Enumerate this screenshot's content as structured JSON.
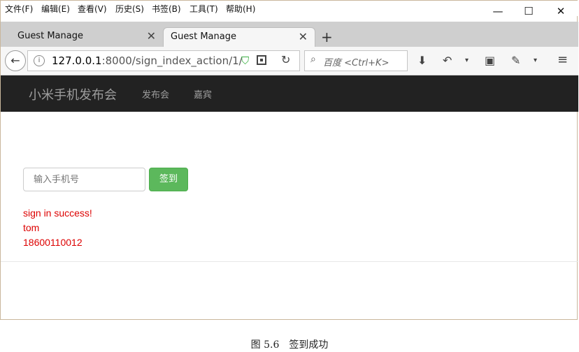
{
  "menubar": {
    "items": [
      "文件(F)",
      "编辑(E)",
      "查看(V)",
      "历史(S)",
      "书签(B)",
      "工具(T)",
      "帮助(H)"
    ]
  },
  "window_controls": {
    "minimize": "—",
    "maximize": "☐",
    "close": "✕"
  },
  "tabs": [
    {
      "title": "Guest Manage",
      "active": false
    },
    {
      "title": "Guest Manage",
      "active": true
    }
  ],
  "toolbar": {
    "url_host": "127.0.0.1",
    "url_rest": ":8000/sign_index_action/1/",
    "search_placeholder": "百度 <Ctrl+K>"
  },
  "site": {
    "brand": "小米手机发布会",
    "nav": [
      "发布会",
      "嘉宾"
    ],
    "phone_placeholder": "输入手机号",
    "sign_button": "签到",
    "messages": [
      "sign in success!",
      "tom",
      "18600110012"
    ]
  },
  "caption": "图 5.6　签到成功",
  "colors": {
    "navbar_bg": "#222222",
    "button": "#5cb85c",
    "message": "#dd0000"
  }
}
